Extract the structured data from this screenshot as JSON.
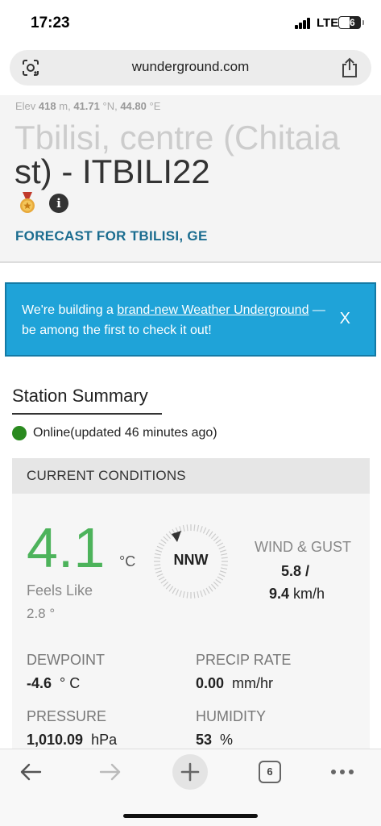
{
  "status_bar": {
    "time": "17:23",
    "network": "LTE",
    "battery": "56"
  },
  "browser": {
    "url": "wunderground.com",
    "tab_count": "6"
  },
  "station": {
    "elev_prefix": "Elev",
    "elev_value": "418",
    "elev_unit": "m,",
    "lat_value": "41.71",
    "lat_unit": "°N,",
    "lon_value": "44.80",
    "lon_unit": "°E",
    "title_line1": "Tbilisi, centre (Chitaia",
    "title_line2": "st) - ITBILI22",
    "forecast_link": "FORECAST FOR TBILISI, GE"
  },
  "banner": {
    "text_before": "We're building a ",
    "link_text": "brand-new Weather Underground",
    "text_after": " — be among the first to check it out!",
    "close_label": "X"
  },
  "summary": {
    "title": "Station Summary",
    "online_text": "Online(updated 46 minutes ago)",
    "online_color": "#2a8a1f"
  },
  "conditions": {
    "header": "CURRENT CONDITIONS",
    "temperature": "4.1",
    "temp_unit": "°C",
    "temp_color": "#4db35b",
    "feels_like_label": "Feels Like",
    "feels_like_value": "2.8 °",
    "wind_direction": "NNW",
    "wind_label": "WIND & GUST",
    "wind_speed": "5.8",
    "wind_sep": "/",
    "gust_speed": "9.4",
    "wind_unit": "km/h",
    "dewpoint_label": "DEWPOINT",
    "dewpoint_value": "-4.6",
    "dewpoint_unit": "° C",
    "precip_label": "PRECIP RATE",
    "precip_value": "0.00",
    "precip_unit": "mm/hr",
    "pressure_label": "PRESSURE",
    "pressure_value": "1,010.09",
    "pressure_unit": "hPa",
    "humidity_label": "HUMIDITY",
    "humidity_value": "53",
    "humidity_unit": "%"
  },
  "icons": {
    "lens": "lens-icon",
    "share": "share-icon",
    "medal": "medal-icon",
    "info": "info-icon",
    "back": "back-arrow-icon",
    "forward": "forward-arrow-icon",
    "new_tab": "plus-icon",
    "tabs": "tabs-icon",
    "more": "more-dots-icon"
  },
  "colors": {
    "banner_bg": "#1fa3d8",
    "link_blue": "#1a6c8f"
  }
}
